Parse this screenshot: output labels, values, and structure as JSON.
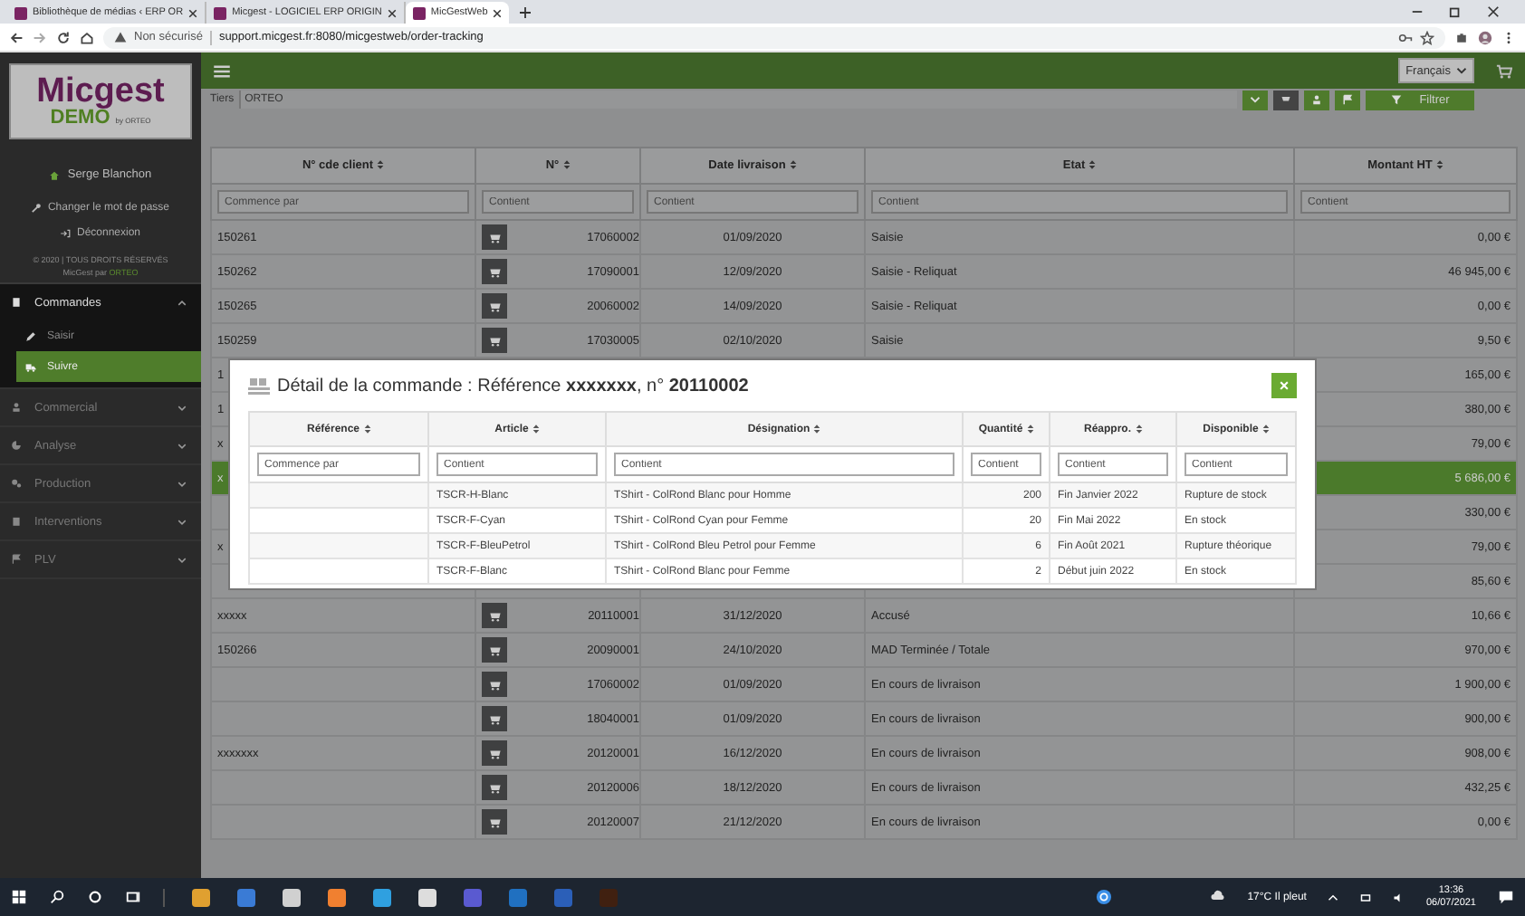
{
  "browser": {
    "tabs": [
      {
        "title": "Bibliothèque de médias ‹ ERP OR",
        "selected": false
      },
      {
        "title": "Micgest - LOGICIEL ERP ORIGIN",
        "selected": false
      },
      {
        "title": "MicGestWeb",
        "selected": true
      }
    ],
    "security": "Non sécurisé",
    "url": "support.micgest.fr:8080/micgestweb/order-tracking"
  },
  "sidebar": {
    "logo": {
      "name": "Micgest",
      "edition": "DEMO",
      "by": "by ORTEO"
    },
    "user": "Serge Blanchon",
    "links": [
      "Changer le mot de passe",
      "Déconnexion"
    ],
    "copyright": "© 2020 | TOUS DROITS RÉSERVÉS",
    "credit": "MicGest par",
    "credit_brand": "ORTEO",
    "menu": [
      {
        "label": "Commandes",
        "expanded": true,
        "children": [
          {
            "label": "Saisir",
            "selected": false
          },
          {
            "label": "Suivre",
            "selected": true
          }
        ]
      },
      {
        "label": "Commercial",
        "expanded": false
      },
      {
        "label": "Analyse",
        "expanded": false
      },
      {
        "label": "Production",
        "expanded": false
      },
      {
        "label": "Interventions",
        "expanded": false
      },
      {
        "label": "PLV",
        "expanded": false
      }
    ]
  },
  "header": {
    "language": "Français"
  },
  "filter_bar": {
    "label": "Tiers",
    "value": "ORTEO",
    "button": "Filtrer"
  },
  "table": {
    "columns": [
      "N° cde client",
      "N°",
      "Date livraison",
      "Etat",
      "Montant HT"
    ],
    "filters": [
      {
        "placeholder": "Commence par"
      },
      {
        "placeholder": "Contient"
      },
      {
        "placeholder": "Contient"
      },
      {
        "placeholder": "Contient"
      },
      {
        "placeholder": "Contient"
      }
    ],
    "rows": [
      {
        "client": "150261",
        "number": "17060002",
        "date": "01/09/2020",
        "state": "Saisie",
        "amount": "0,00 €",
        "selected": false
      },
      {
        "client": "150262",
        "number": "17090001",
        "date": "12/09/2020",
        "state": "Saisie - Reliquat",
        "amount": "46 945,00 €",
        "selected": false
      },
      {
        "client": "150265",
        "number": "20060002",
        "date": "14/09/2020",
        "state": "Saisie - Reliquat",
        "amount": "0,00 €",
        "selected": false
      },
      {
        "client": "150259",
        "number": "17030005",
        "date": "02/10/2020",
        "state": "Saisie",
        "amount": "9,50 €",
        "selected": false
      },
      {
        "client": "1",
        "amount": "165,00 €",
        "selected": false
      },
      {
        "client": "1",
        "amount": "380,00 €",
        "selected": false
      },
      {
        "client": "x",
        "amount": "79,00 €",
        "selected": false
      },
      {
        "client": "x",
        "amount": "5 686,00 €",
        "selected": true
      },
      {
        "amount": "330,00 €",
        "selected": false
      },
      {
        "client": "x",
        "amount": "79,00 €",
        "selected": false
      },
      {
        "amount": "85,60 €",
        "selected": false
      },
      {
        "client": "xxxxx",
        "number": "20110001",
        "date": "31/12/2020",
        "state": "Accusé",
        "amount": "10,66 €",
        "selected": false
      },
      {
        "client": "150266",
        "number": "20090001",
        "date": "24/10/2020",
        "state": "MAD Terminée / Totale",
        "amount": "970,00 €",
        "selected": false
      },
      {
        "number": "17060002",
        "date": "01/09/2020",
        "state": "En cours de livraison",
        "amount": "1 900,00 €",
        "selected": false
      },
      {
        "number": "18040001",
        "date": "01/09/2020",
        "state": "En cours de livraison",
        "amount": "900,00 €",
        "selected": false
      },
      {
        "client": "xxxxxxx",
        "number": "20120001",
        "date": "16/12/2020",
        "state": "En cours de livraison",
        "amount": "908,00 €",
        "selected": false
      },
      {
        "number": "20120006",
        "date": "18/12/2020",
        "state": "En cours de livraison",
        "amount": "432,25 €",
        "selected": false
      },
      {
        "number": "20120007",
        "date": "21/12/2020",
        "state": "En cours de livraison",
        "amount": "0,00 €",
        "selected": false
      }
    ]
  },
  "modal": {
    "title": "Détail de la commande : Référence **xxxxxxx**, n° **20110002**",
    "close": "×",
    "columns": [
      "Référence",
      "Article",
      "Désignation",
      "Quantité",
      "Réappro.",
      "Disponible"
    ],
    "filters": [
      {
        "placeholder": "Commence par"
      },
      {
        "placeholder": "Contient"
      },
      {
        "placeholder": "Contient"
      },
      {
        "placeholder": "Contient"
      },
      {
        "placeholder": "Contient"
      },
      {
        "placeholder": "Contient"
      }
    ],
    "rows": [
      {
        "article": "TSCR-H-Blanc",
        "designation": "TShirt - ColRond Blanc pour Homme",
        "quantity": "200",
        "restock": "Fin Janvier 2022",
        "availability": "Rupture de stock"
      },
      {
        "article": "TSCR-F-Cyan",
        "designation": "TShirt - ColRond Cyan pour Femme",
        "quantity": "20",
        "restock": "Fin Mai 2022",
        "availability": "En stock"
      },
      {
        "article": "TSCR-F-BleuPetrol",
        "designation": "TShirt - ColRond Bleu Petrol pour Femme",
        "quantity": "6",
        "restock": "Fin Août 2021",
        "availability": "Rupture théorique"
      },
      {
        "article": "TSCR-F-Blanc",
        "designation": "TShirt - ColRond Blanc pour Femme",
        "quantity": "2",
        "restock": "Début juin 2022",
        "availability": "En stock"
      }
    ]
  },
  "taskbar": {
    "weather": "17°C Il pleut",
    "time": "13:36",
    "date": "06/07/2021"
  }
}
